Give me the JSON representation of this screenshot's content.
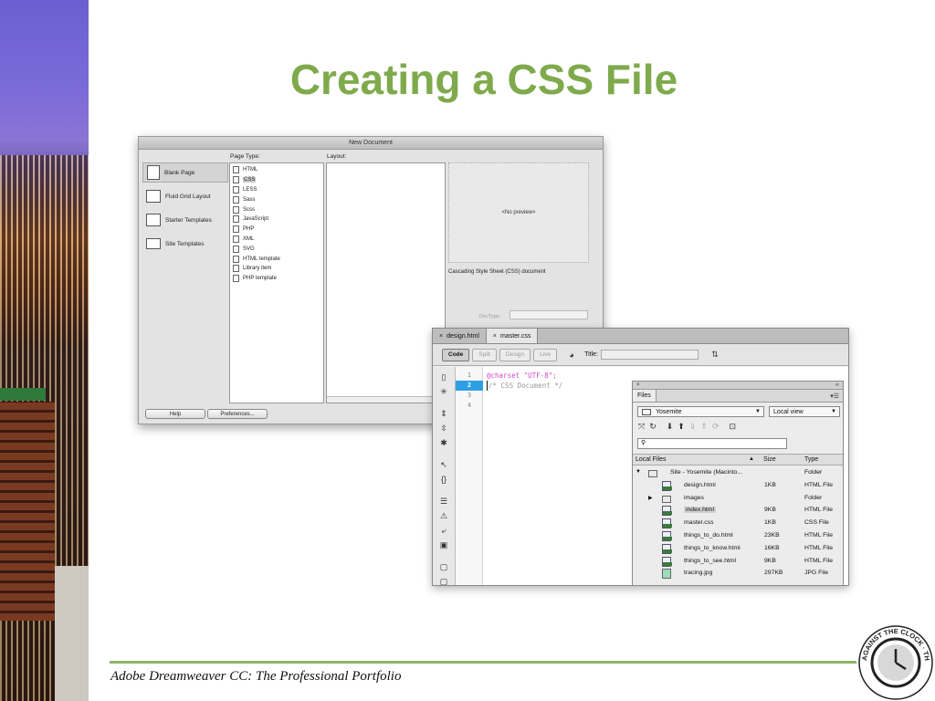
{
  "slide": {
    "title": "Creating a CSS File",
    "footer": "Adobe Dreamweaver CC: The Professional Portfolio",
    "logo_text": "AGAINST THE CLOCK · THE AUTHORITY IN COMPUTER ARTS"
  },
  "new_document": {
    "title": "New Document",
    "categories": [
      "Blank Page",
      "Fluid Grid Layout",
      "Starter Templates",
      "Site Templates"
    ],
    "selected_category": "Blank Page",
    "page_type_label": "Page Type:",
    "layout_label": "Layout:",
    "page_types": [
      "HTML",
      "CSS",
      "LESS",
      "Sass",
      "Scss",
      "JavaScript",
      "PHP",
      "XML",
      "SVG",
      "HTML template",
      "Library item",
      "PHP template"
    ],
    "selected_page_type": "CSS",
    "preview_text": "<No preview>",
    "description": "Cascading Style Sheet (CSS) document",
    "doctype_label": "DocType:",
    "help_label": "Help",
    "preferences_label": "Preferences..."
  },
  "editor": {
    "tabs": [
      {
        "label": "design.html",
        "active": false
      },
      {
        "label": "master.css",
        "active": true
      }
    ],
    "view_buttons": [
      "Code",
      "Split",
      "Design",
      "Live"
    ],
    "active_view": "Code",
    "title_label": "Title:",
    "title_value": "",
    "line_numbers": [
      "1",
      "2",
      "3",
      "4"
    ],
    "current_line": "2",
    "code_lines": [
      "@charset \"UTF-8\";",
      "/* CSS Document */"
    ],
    "colors": {
      "at_rule": "#d048c8",
      "comment": "#9a9a9a",
      "current_line": "#2f9fe4"
    }
  },
  "files_panel": {
    "tab_label": "Files",
    "site_select": "Yosemite",
    "view_select": "Local view",
    "search_placeholder": "",
    "columns": {
      "name": "Local Files",
      "size": "Size",
      "type": "Type"
    },
    "rows": [
      {
        "name": "Site - Yosemite (Macinto...",
        "size": "",
        "type": "Folder",
        "icon": "folder",
        "indent": 0,
        "expander": "▼"
      },
      {
        "name": "design.html",
        "size": "1KB",
        "type": "HTML File",
        "icon": "dw-file",
        "indent": 1,
        "expander": ""
      },
      {
        "name": "images",
        "size": "",
        "type": "Folder",
        "icon": "folder",
        "indent": 1,
        "expander": "▶"
      },
      {
        "name": "index.html",
        "size": "9KB",
        "type": "HTML File",
        "icon": "dw-file",
        "indent": 1,
        "expander": "",
        "highlighted": true
      },
      {
        "name": "master.css",
        "size": "1KB",
        "type": "CSS File",
        "icon": "dw-file",
        "indent": 1,
        "expander": ""
      },
      {
        "name": "things_to_do.html",
        "size": "23KB",
        "type": "HTML File",
        "icon": "dw-file",
        "indent": 1,
        "expander": ""
      },
      {
        "name": "things_to_know.html",
        "size": "16KB",
        "type": "HTML File",
        "icon": "dw-file",
        "indent": 1,
        "expander": ""
      },
      {
        "name": "things_to_see.html",
        "size": "9KB",
        "type": "HTML File",
        "icon": "dw-file",
        "indent": 1,
        "expander": ""
      },
      {
        "name": "tracing.jpg",
        "size": "297KB",
        "type": "JPG File",
        "icon": "img",
        "indent": 1,
        "expander": ""
      }
    ]
  },
  "theme": {
    "title_green": "#7faa4c",
    "rule_green": "#8db464"
  }
}
